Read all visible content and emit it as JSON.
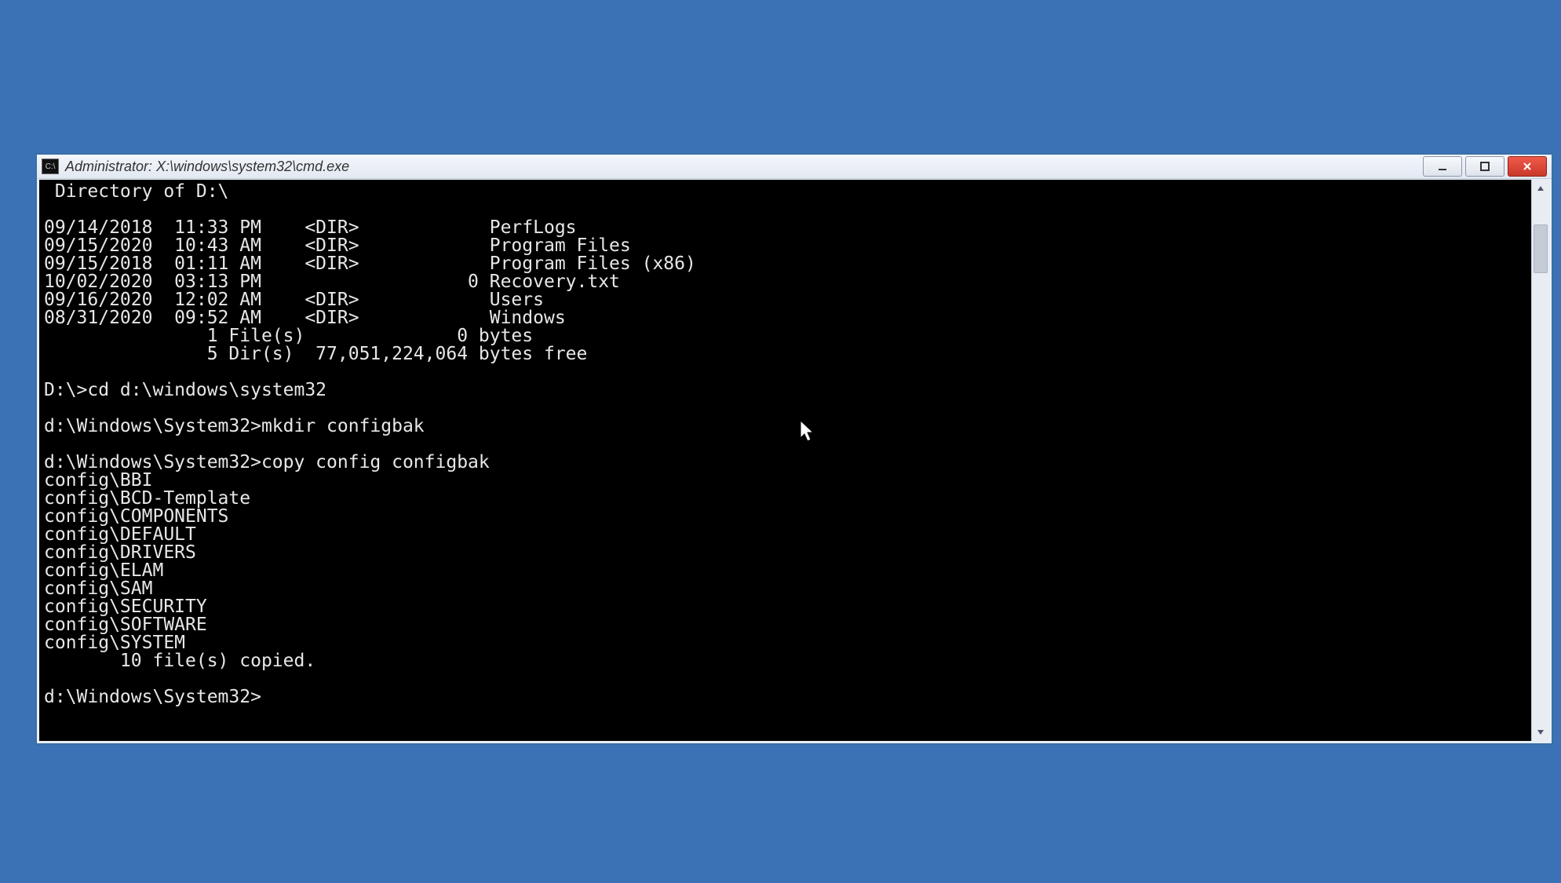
{
  "window": {
    "title": "Administrator: X:\\windows\\system32\\cmd.exe"
  },
  "terminal": {
    "header": " Directory of D:\\",
    "dir_rows": [
      {
        "date": "09/14/2018",
        "time": "11:33 PM",
        "dir": "<DIR>",
        "size": "",
        "name": "PerfLogs"
      },
      {
        "date": "09/15/2020",
        "time": "10:43 AM",
        "dir": "<DIR>",
        "size": "",
        "name": "Program Files"
      },
      {
        "date": "09/15/2018",
        "time": "01:11 AM",
        "dir": "<DIR>",
        "size": "",
        "name": "Program Files (x86)"
      },
      {
        "date": "10/02/2020",
        "time": "03:13 PM",
        "dir": "",
        "size": "0",
        "name": "Recovery.txt"
      },
      {
        "date": "09/16/2020",
        "time": "12:02 AM",
        "dir": "<DIR>",
        "size": "",
        "name": "Users"
      },
      {
        "date": "08/31/2020",
        "time": "09:52 AM",
        "dir": "<DIR>",
        "size": "",
        "name": "Windows"
      }
    ],
    "summary_files": "               1 File(s)              0 bytes",
    "summary_dirs": "               5 Dir(s)  77,051,224,064 bytes free",
    "cmd1_prompt": "D:\\>",
    "cmd1_cmd": "cd d:\\windows\\system32",
    "cmd2_prompt": "d:\\Windows\\System32>",
    "cmd2_cmd": "mkdir configbak",
    "cmd3_prompt": "d:\\Windows\\System32>",
    "cmd3_cmd": "copy config configbak",
    "copy_lines": [
      "config\\BBI",
      "config\\BCD-Template",
      "config\\COMPONENTS",
      "config\\DEFAULT",
      "config\\DRIVERS",
      "config\\ELAM",
      "config\\SAM",
      "config\\SECURITY",
      "config\\SOFTWARE",
      "config\\SYSTEM"
    ],
    "copy_summary": "       10 file(s) copied.",
    "final_prompt": "d:\\Windows\\System32>"
  }
}
